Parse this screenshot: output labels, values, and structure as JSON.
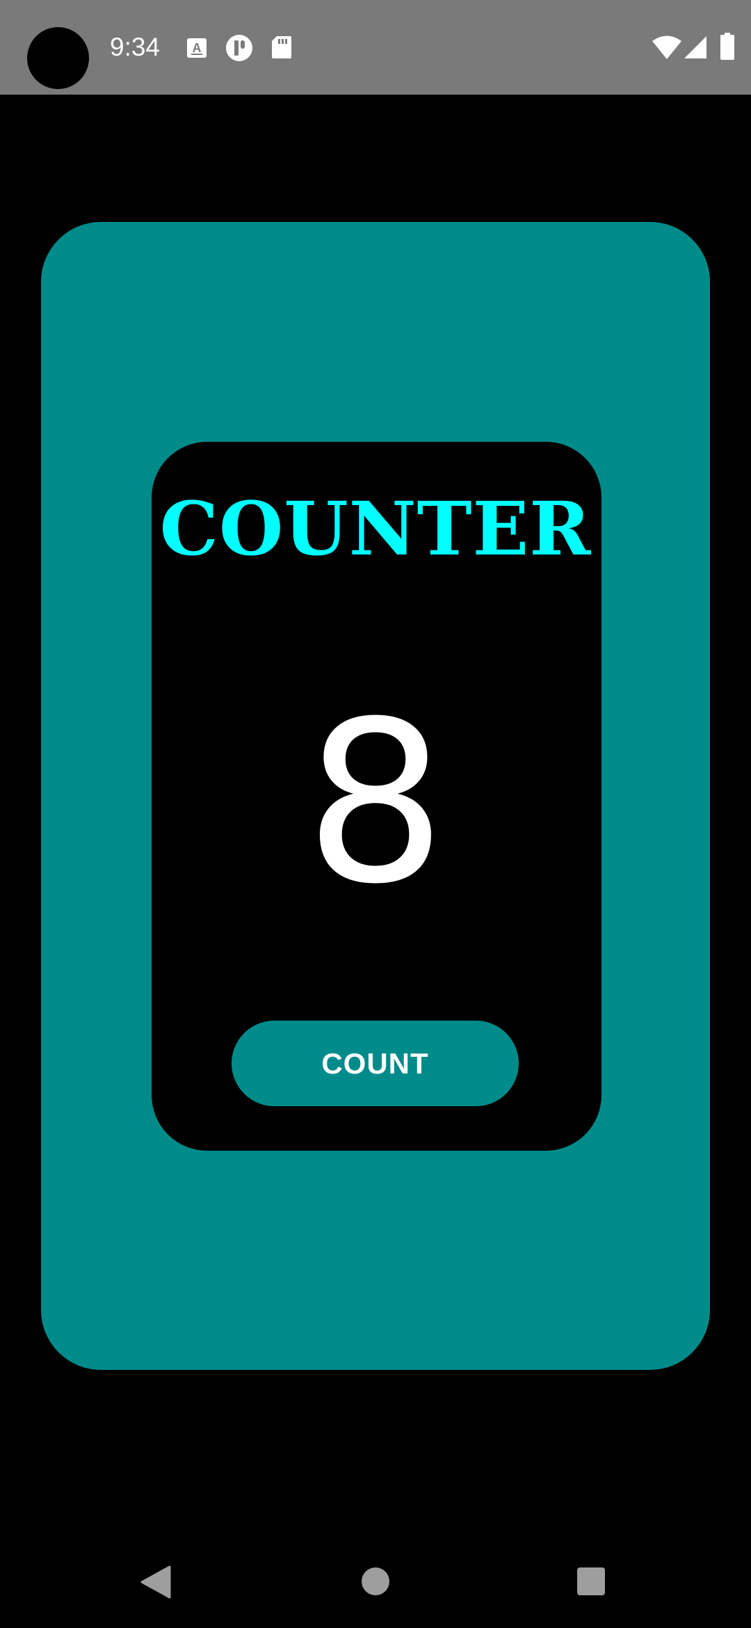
{
  "status_bar": {
    "time": "9:34",
    "icons": [
      "text-a-icon",
      "app-notification-icon",
      "sd-card-icon",
      "wifi-icon",
      "cell-signal-icon",
      "battery-icon"
    ]
  },
  "counter": {
    "title": "COUNTER",
    "value": "8",
    "button_label": "COUNT"
  },
  "colors": {
    "background": "#000000",
    "teal": "#008b8b",
    "title_cyan": "#00ffff",
    "status_bar": "#7a7a7a"
  },
  "nav_bar": {
    "icons": [
      "back-icon",
      "home-icon",
      "recents-icon"
    ]
  }
}
